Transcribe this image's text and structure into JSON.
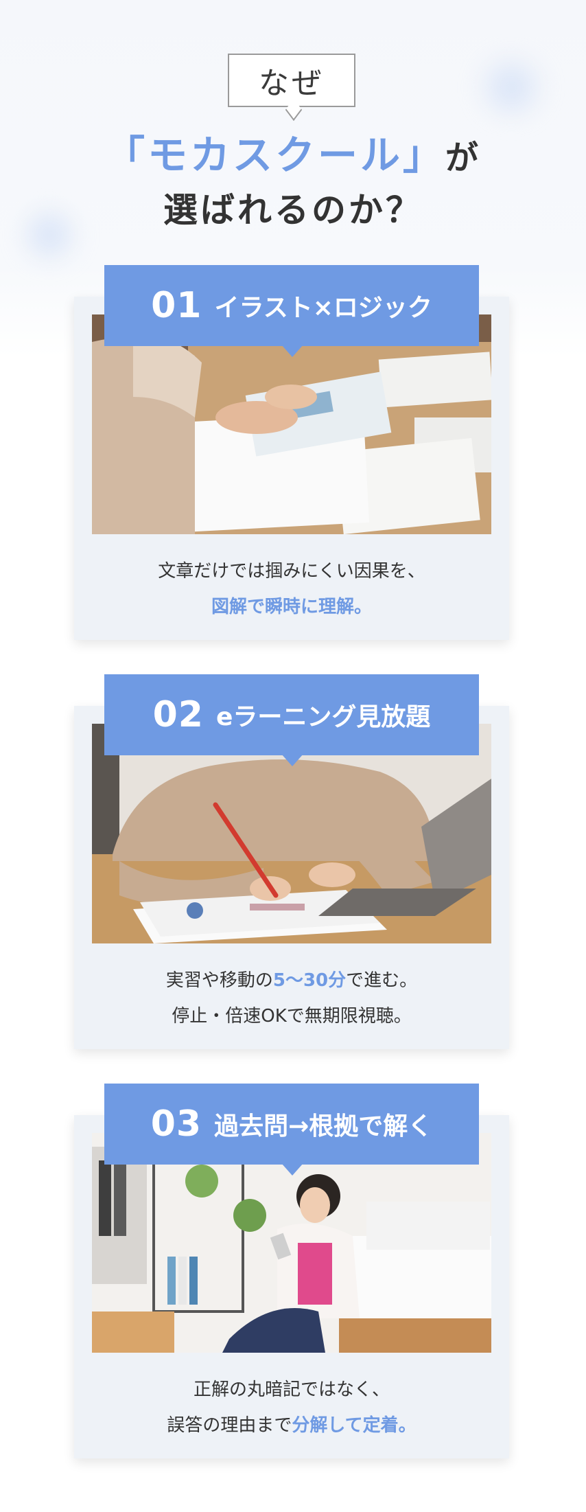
{
  "heading": {
    "badge": "なぜ",
    "brand": "「モカスクール」",
    "suffix": "が",
    "line2": "選ばれるのか？"
  },
  "colors": {
    "accent": "#6f9ae3",
    "card_bg": "#eef2f7",
    "text": "#333333"
  },
  "features": [
    {
      "number": "01",
      "title": "イラスト×ロジック",
      "photo": "study-notebook-photo",
      "text_line1": "文章だけでは掴みにくい因果を、",
      "text_line2_highlight": "図解で瞬時に理解。"
    },
    {
      "number": "02",
      "title": "eラーニング見放題",
      "photo": "writing-with-laptop-photo",
      "text_line1_before": "実習や移動の",
      "text_line1_highlight": "5〜30分",
      "text_line1_after": "で進む。",
      "text_line2": "停止・倍速OKで無期限視聴。"
    },
    {
      "number": "03",
      "title": "過去問→根拠で解く",
      "photo": "woman-with-smartphone-photo",
      "text_line1": "正解の丸暗記ではなく、",
      "text_line2_before": "誤答の理由まで",
      "text_line2_highlight": "分解して定着。"
    }
  ]
}
